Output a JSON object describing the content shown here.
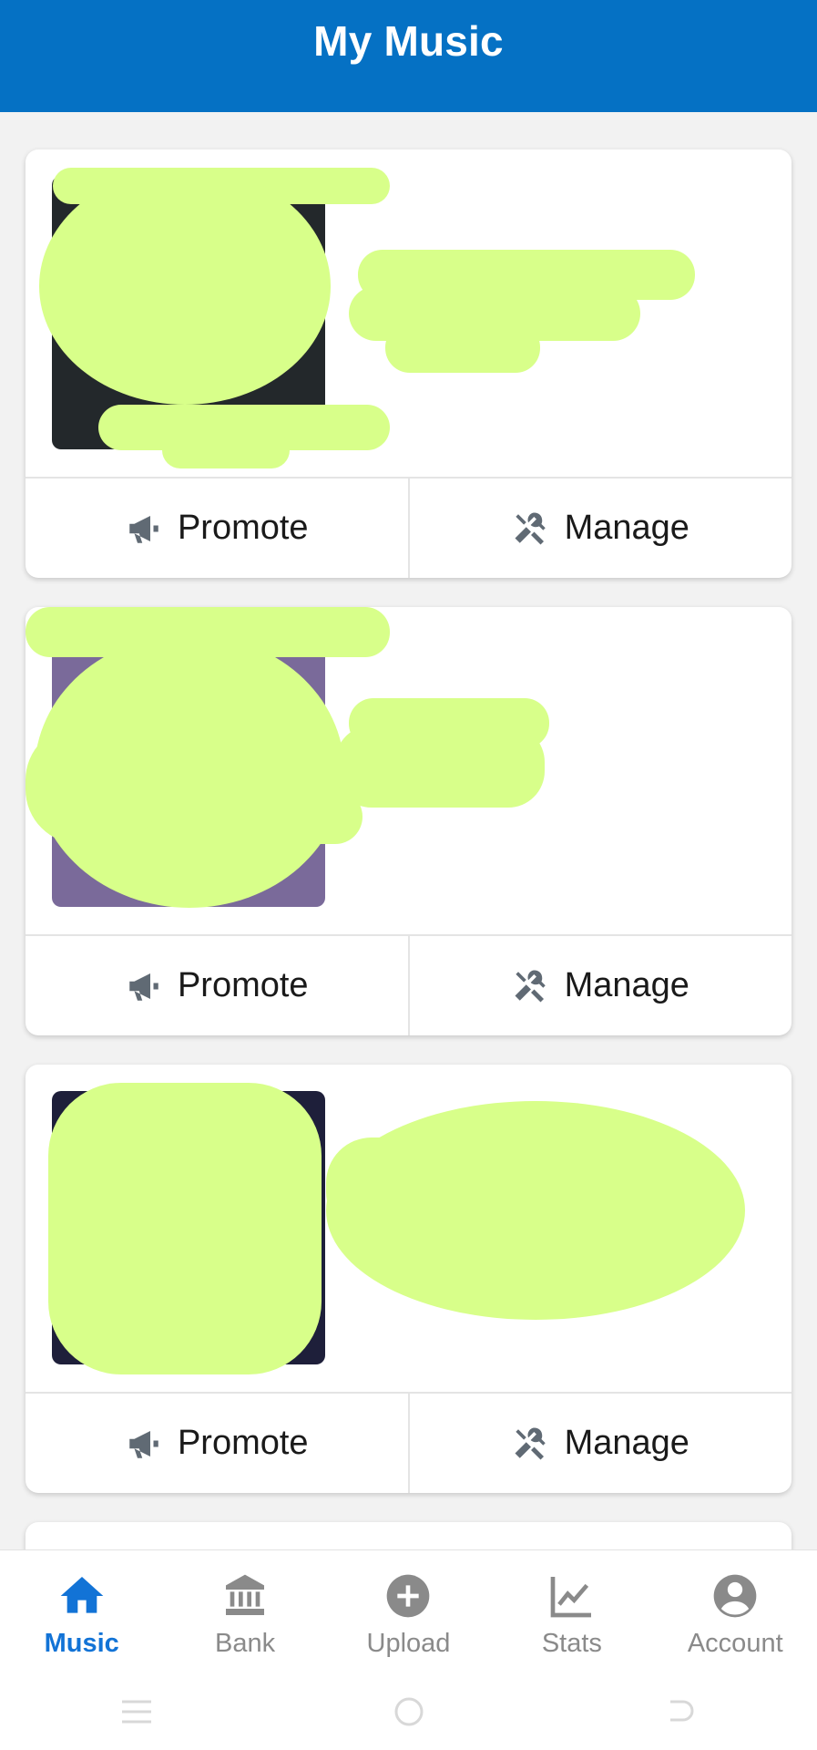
{
  "header": {
    "title": "My Music"
  },
  "cards": [
    {
      "promote_label": "Promote",
      "manage_label": "Manage"
    },
    {
      "promote_label": "Promote",
      "manage_label": "Manage"
    },
    {
      "promote_label": "Promote",
      "manage_label": "Manage"
    }
  ],
  "nav": [
    {
      "label": "Music",
      "icon": "home-icon",
      "active": true
    },
    {
      "label": "Bank",
      "icon": "bank-icon",
      "active": false
    },
    {
      "label": "Upload",
      "icon": "plus-circle-icon",
      "active": false
    },
    {
      "label": "Stats",
      "icon": "chart-line-icon",
      "active": false
    },
    {
      "label": "Account",
      "icon": "account-circle-icon",
      "active": false
    }
  ],
  "colors": {
    "header_bg": "#0571c4",
    "active_nav": "#1273d6",
    "inactive_nav": "#8a8a8a",
    "redaction": "#d8ff8a"
  }
}
